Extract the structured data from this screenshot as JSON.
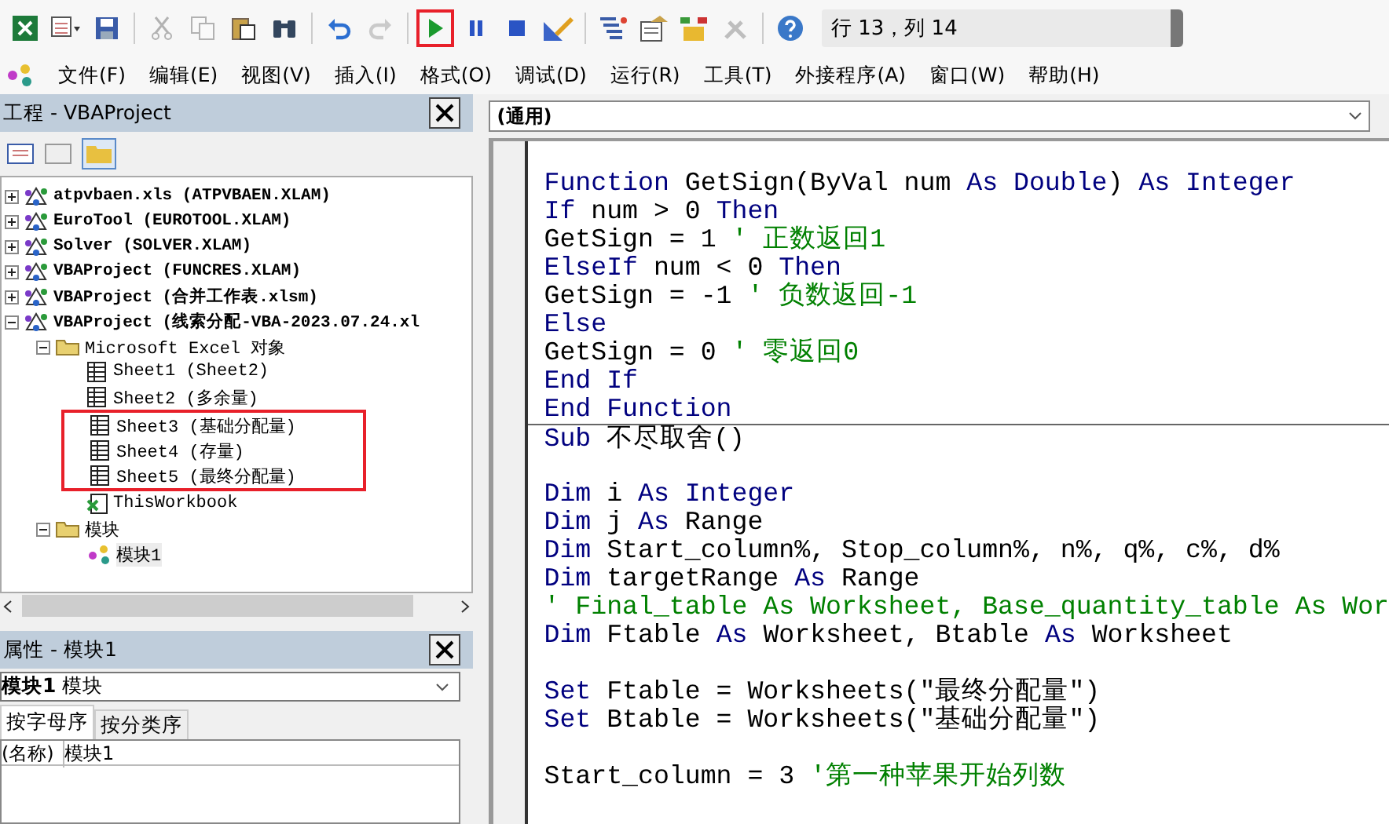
{
  "toolbar": {
    "buttons": [
      {
        "kind": "excel",
        "disabled": false,
        "highlighted": false
      },
      {
        "kind": "insert",
        "disabled": false,
        "highlighted": false
      },
      {
        "kind": "save",
        "disabled": false,
        "highlighted": false
      },
      {
        "kind": "cut",
        "disabled": true,
        "highlighted": false
      },
      {
        "kind": "copy",
        "disabled": true,
        "highlighted": false
      },
      {
        "kind": "paste",
        "disabled": false,
        "highlighted": false
      },
      {
        "kind": "find",
        "disabled": false,
        "highlighted": false
      },
      {
        "kind": "undo",
        "disabled": false,
        "highlighted": false
      },
      {
        "kind": "redo",
        "disabled": true,
        "highlighted": false
      },
      {
        "kind": "run",
        "disabled": false,
        "highlighted": true
      },
      {
        "kind": "pause",
        "disabled": false,
        "highlighted": false
      },
      {
        "kind": "stop",
        "disabled": false,
        "highlighted": false
      },
      {
        "kind": "design",
        "disabled": false,
        "highlighted": false
      },
      {
        "kind": "explorer",
        "disabled": false,
        "highlighted": false
      },
      {
        "kind": "properties",
        "disabled": false,
        "highlighted": false
      },
      {
        "kind": "browser",
        "disabled": false,
        "highlighted": false
      },
      {
        "kind": "toolbox",
        "disabled": true,
        "highlighted": false
      },
      {
        "kind": "help",
        "disabled": false,
        "highlighted": false
      }
    ],
    "position": "行 13，列 14"
  },
  "menu": [
    "文件(F)",
    "编辑(E)",
    "视图(V)",
    "插入(I)",
    "格式(O)",
    "调试(D)",
    "运行(R)",
    "工具(T)",
    "外接程序(A)",
    "窗口(W)",
    "帮助(H)"
  ],
  "project": {
    "title": "工程 - VBAProject",
    "tree": [
      {
        "label": "atpvbaen.xls (ATPVBAEN.XLAM)",
        "kind": "project",
        "expanded": false,
        "highlighted": false
      },
      {
        "label": "EuroTool (EUROTOOL.XLAM)",
        "kind": "project",
        "expanded": false,
        "highlighted": false
      },
      {
        "label": "Solver (SOLVER.XLAM)",
        "kind": "project",
        "expanded": false,
        "highlighted": false
      },
      {
        "label": "VBAProject (FUNCRES.XLAM)",
        "kind": "project",
        "expanded": false,
        "highlighted": false
      },
      {
        "label": "VBAProject (合并工作表.xlsm)",
        "kind": "project",
        "expanded": false,
        "highlighted": false
      },
      {
        "label": "VBAProject (线索分配-VBA-2023.07.24.xl",
        "kind": "project",
        "expanded": true,
        "highlighted": false,
        "children": [
          {
            "label": "Microsoft Excel 对象",
            "kind": "folder",
            "expanded": true,
            "highlighted": false,
            "children": [
              {
                "label": "Sheet1 (Sheet2)",
                "kind": "sheet",
                "highlighted": false
              },
              {
                "label": "Sheet2 (多余量)",
                "kind": "sheet",
                "highlighted": false
              },
              {
                "label": "Sheet3 (基础分配量)",
                "kind": "sheet",
                "highlighted": true
              },
              {
                "label": "Sheet4 (存量)",
                "kind": "sheet",
                "highlighted": true
              },
              {
                "label": "Sheet5 (最终分配量)",
                "kind": "sheet",
                "highlighted": true
              },
              {
                "label": "ThisWorkbook",
                "kind": "workbook",
                "highlighted": false
              }
            ]
          },
          {
            "label": "模块",
            "kind": "folder",
            "expanded": true,
            "highlighted": false,
            "children": [
              {
                "label": "模块1",
                "kind": "module",
                "highlighted": false,
                "selected": true
              }
            ]
          }
        ]
      }
    ]
  },
  "properties": {
    "title": "属性 - 模块1",
    "object_name": "模块1",
    "object_type": "模块",
    "tabs": [
      {
        "label": "按字母序",
        "selected": true
      },
      {
        "label": "按分类序",
        "selected": false
      }
    ],
    "rows": [
      {
        "name": "(名称)",
        "value": "模块1"
      }
    ]
  },
  "code": {
    "object": "(通用)",
    "lines": [
      {
        "divider": false
      },
      {
        "divider": false,
        "segments": [
          {
            "kind": "kw",
            "text": "Function"
          },
          {
            "kind": "plain",
            "text": " GetSign(ByVal num "
          },
          {
            "kind": "kw",
            "text": "As Double"
          },
          {
            "kind": "plain",
            "text": ") "
          },
          {
            "kind": "kw",
            "text": "As Integer"
          }
        ]
      },
      {
        "divider": false,
        "segments": [
          {
            "kind": "kw",
            "text": "If"
          },
          {
            "kind": "plain",
            "text": " num > 0 "
          },
          {
            "kind": "kw",
            "text": "Then"
          }
        ]
      },
      {
        "divider": false,
        "segments": [
          {
            "kind": "plain",
            "text": "GetSign = 1 "
          },
          {
            "kind": "comment",
            "text": "' 正数返回1"
          }
        ]
      },
      {
        "divider": false,
        "segments": [
          {
            "kind": "kw",
            "text": "ElseIf"
          },
          {
            "kind": "plain",
            "text": " num < 0 "
          },
          {
            "kind": "kw",
            "text": "Then"
          }
        ]
      },
      {
        "divider": false,
        "segments": [
          {
            "kind": "plain",
            "text": "GetSign = -1 "
          },
          {
            "kind": "comment",
            "text": "' 负数返回-1"
          }
        ]
      },
      {
        "divider": false,
        "segments": [
          {
            "kind": "kw",
            "text": "Else"
          }
        ]
      },
      {
        "divider": false,
        "segments": [
          {
            "kind": "plain",
            "text": "GetSign = 0 "
          },
          {
            "kind": "comment",
            "text": "' 零返回0"
          }
        ]
      },
      {
        "divider": false,
        "segments": [
          {
            "kind": "kw",
            "text": "End If"
          }
        ]
      },
      {
        "divider": false,
        "segments": [
          {
            "kind": "kw",
            "text": "End Function"
          }
        ]
      },
      {
        "divider": true,
        "segments": [
          {
            "kind": "kw",
            "text": "Sub"
          },
          {
            "kind": "plain",
            "text": " 不尽取舍()"
          }
        ]
      },
      {
        "divider": false
      },
      {
        "divider": false,
        "segments": [
          {
            "kind": "kw",
            "text": "Dim"
          },
          {
            "kind": "plain",
            "text": " i "
          },
          {
            "kind": "kw",
            "text": "As Integer"
          }
        ]
      },
      {
        "divider": false,
        "segments": [
          {
            "kind": "kw",
            "text": "Dim"
          },
          {
            "kind": "plain",
            "text": " j "
          },
          {
            "kind": "kw",
            "text": "As"
          },
          {
            "kind": "plain",
            "text": " Range"
          }
        ]
      },
      {
        "divider": false,
        "segments": [
          {
            "kind": "kw",
            "text": "Dim"
          },
          {
            "kind": "plain",
            "text": " Start_column%, Stop_column%, n%, q%, c%, d%"
          }
        ]
      },
      {
        "divider": false,
        "segments": [
          {
            "kind": "kw",
            "text": "Dim"
          },
          {
            "kind": "plain",
            "text": " targetRange "
          },
          {
            "kind": "kw",
            "text": "As"
          },
          {
            "kind": "plain",
            "text": " Range"
          }
        ]
      },
      {
        "divider": false,
        "segments": [
          {
            "kind": "comment",
            "text": "' Final_table As Worksheet, Base_quantity_table As Wor"
          }
        ]
      },
      {
        "divider": false,
        "segments": [
          {
            "kind": "kw",
            "text": "Dim"
          },
          {
            "kind": "plain",
            "text": " Ftable "
          },
          {
            "kind": "kw",
            "text": "As"
          },
          {
            "kind": "plain",
            "text": " Worksheet, Btable "
          },
          {
            "kind": "kw",
            "text": "As"
          },
          {
            "kind": "plain",
            "text": " Worksheet"
          }
        ]
      },
      {
        "divider": false
      },
      {
        "divider": false,
        "segments": [
          {
            "kind": "kw",
            "text": "Set"
          },
          {
            "kind": "plain",
            "text": " Ftable = Worksheets(\"最终分配量\")"
          }
        ]
      },
      {
        "divider": false,
        "segments": [
          {
            "kind": "kw",
            "text": "Set"
          },
          {
            "kind": "plain",
            "text": " Btable = Worksheets(\"基础分配量\")"
          }
        ]
      },
      {
        "divider": false
      },
      {
        "divider": false,
        "segments": [
          {
            "kind": "plain",
            "text": "Start_column = 3 "
          },
          {
            "kind": "comment",
            "text": "'第一种苹果开始列数"
          }
        ]
      }
    ]
  }
}
